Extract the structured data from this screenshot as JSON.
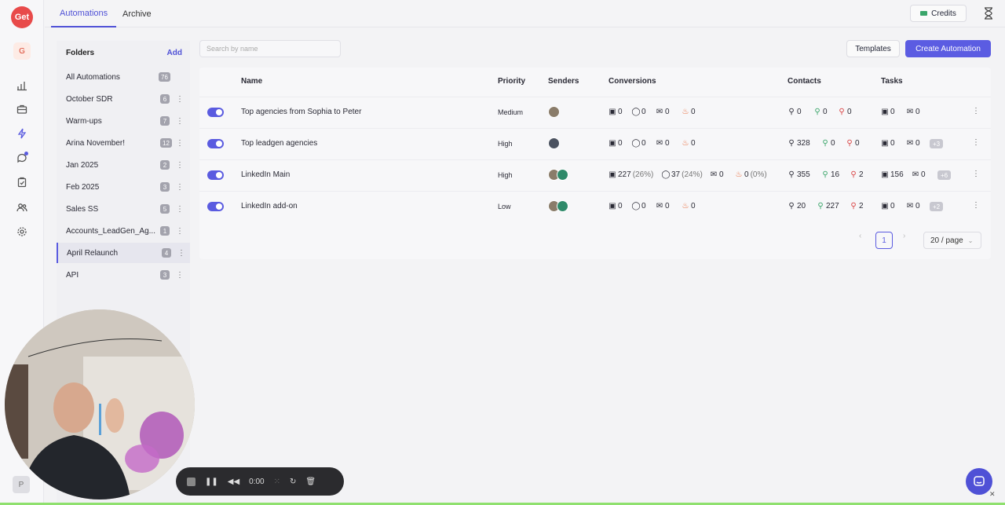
{
  "rail": {
    "logo": "Get",
    "workspace_initial": "G",
    "profile_initial": "P",
    "icons": [
      "bar-chart-icon",
      "briefcase-icon",
      "lightning-icon",
      "chat-icon",
      "clipboard-icon",
      "users-icon",
      "gear-icon"
    ]
  },
  "topbar": {
    "tabs": [
      "Automations",
      "Archive"
    ],
    "credits": "Credits"
  },
  "folders": {
    "title": "Folders",
    "add": "Add",
    "items": [
      {
        "name": "All Automations",
        "count": "76"
      },
      {
        "name": "October SDR",
        "count": "6"
      },
      {
        "name": "Warm-ups",
        "count": "7"
      },
      {
        "name": "Arina November!",
        "count": "12"
      },
      {
        "name": "Jan 2025",
        "count": "2"
      },
      {
        "name": "Feb 2025",
        "count": "3"
      },
      {
        "name": "Sales SS",
        "count": "5"
      },
      {
        "name": "Accounts_LeadGen_Ag...",
        "count": "1"
      },
      {
        "name": "April Relaunch",
        "count": "4"
      },
      {
        "name": "API",
        "count": "3"
      }
    ]
  },
  "toolbar": {
    "search_placeholder": "Search by name",
    "templates": "Templates",
    "create": "Create Automation"
  },
  "table": {
    "headers": {
      "name": "Name",
      "priority": "Priority",
      "senders": "Senders",
      "conversions": "Conversions",
      "contacts": "Contacts",
      "tasks": "Tasks"
    },
    "rows": [
      {
        "name": "Top agencies from Sophia to Peter",
        "priority": "Medium",
        "conv": [
          "0",
          "0",
          "0",
          "0"
        ],
        "conv_pct": [
          "",
          "",
          "",
          ""
        ],
        "contacts": [
          "0",
          "0",
          "0"
        ],
        "tasks": [
          "0",
          "0"
        ],
        "more": ""
      },
      {
        "name": "Top leadgen agencies",
        "priority": "High",
        "conv": [
          "0",
          "0",
          "0",
          "0"
        ],
        "conv_pct": [
          "",
          "",
          "",
          ""
        ],
        "contacts": [
          "328",
          "0",
          "0"
        ],
        "tasks": [
          "0",
          "0"
        ],
        "more": "+3"
      },
      {
        "name": "LinkedIn Main",
        "priority": "High",
        "conv": [
          "227",
          "37",
          "0",
          "0"
        ],
        "conv_pct": [
          "(26%)",
          "(24%)",
          "",
          "(0%)"
        ],
        "contacts": [
          "355",
          "16",
          "2"
        ],
        "tasks": [
          "156",
          "0"
        ],
        "more": "+6"
      },
      {
        "name": "LinkedIn add-on",
        "priority": "Low",
        "conv": [
          "0",
          "0",
          "0",
          "0"
        ],
        "conv_pct": [
          "",
          "",
          "",
          ""
        ],
        "contacts": [
          "20",
          "227",
          "2"
        ],
        "tasks": [
          "0",
          "0"
        ],
        "more": "+2"
      }
    ]
  },
  "pagination": {
    "prev": "‹",
    "page": "1",
    "next": "›",
    "page_size": "20 / page"
  },
  "recorder": {
    "time": "0:00"
  }
}
